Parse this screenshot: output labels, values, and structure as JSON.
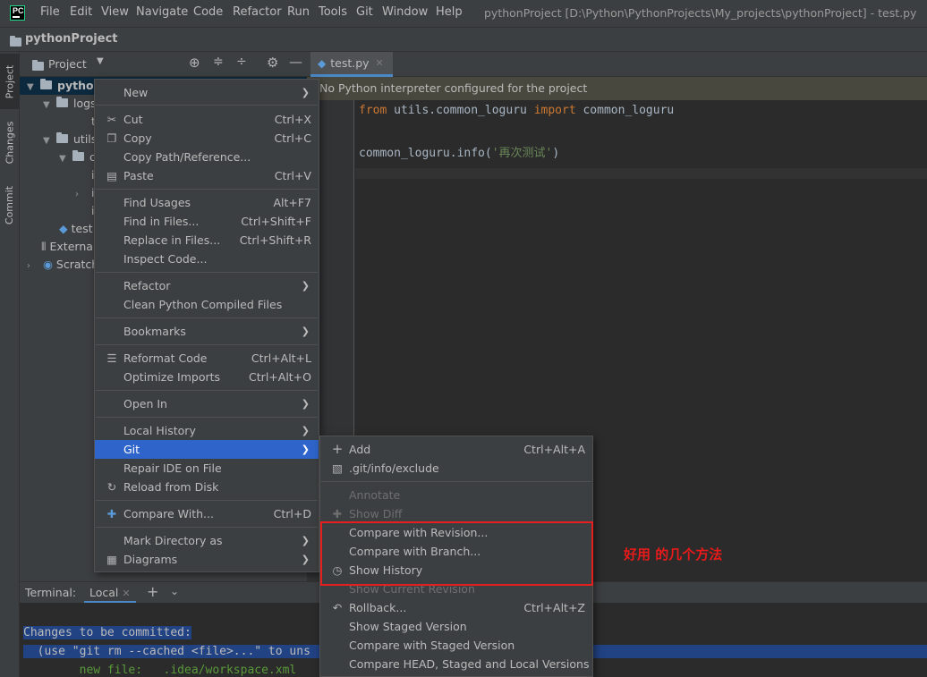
{
  "menubar": {
    "logo": "PC",
    "items": [
      "File",
      "Edit",
      "View",
      "Navigate",
      "Code",
      "Refactor",
      "Run",
      "Tools",
      "Git",
      "Window",
      "Help"
    ],
    "window_title": "pythonProject [D:\\Python\\PythonProjects\\My_projects\\pythonProject] - test.py"
  },
  "navbar": {
    "project": "pythonProject"
  },
  "tool_strip": {
    "project": "Project",
    "changes": "Changes",
    "commit": "Commit"
  },
  "project_panel": {
    "title": "Project",
    "tree": {
      "root": "pythonProject",
      "logs": "logs",
      "logs_child": "t",
      "utils": "utils",
      "utils_child": "c",
      "i1": "i",
      "i2": "i",
      "i3": "i",
      "test": "test",
      "external": "External",
      "scratches": "Scratch"
    }
  },
  "editor": {
    "tab": "test.py",
    "warning": "No Python interpreter configured for the project",
    "code": {
      "l1_from": "from",
      "l1_mod": " utils.common_loguru ",
      "l1_import": "import",
      "l1_name": " common_loguru",
      "l3_call": "common_loguru.info(",
      "l3_str": "'再次测试'",
      "l3_end": ")"
    }
  },
  "context_menu": {
    "new": "New",
    "cut": "Cut",
    "cut_sc": "Ctrl+X",
    "copy": "Copy",
    "copy_sc": "Ctrl+C",
    "copy_path": "Copy Path/Reference...",
    "paste": "Paste",
    "paste_sc": "Ctrl+V",
    "find_usages": "Find Usages",
    "find_usages_sc": "Alt+F7",
    "find_in_files": "Find in Files...",
    "find_in_files_sc": "Ctrl+Shift+F",
    "replace_in_files": "Replace in Files...",
    "replace_in_files_sc": "Ctrl+Shift+R",
    "inspect_code": "Inspect Code...",
    "refactor": "Refactor",
    "clean_python": "Clean Python Compiled Files",
    "bookmarks": "Bookmarks",
    "reformat": "Reformat Code",
    "reformat_sc": "Ctrl+Alt+L",
    "optimize": "Optimize Imports",
    "optimize_sc": "Ctrl+Alt+O",
    "open_in": "Open In",
    "local_history": "Local History",
    "git": "Git",
    "repair_ide": "Repair IDE on File",
    "reload": "Reload from Disk",
    "compare_with": "Compare With...",
    "compare_with_sc": "Ctrl+D",
    "mark_dir": "Mark Directory as",
    "diagrams": "Diagrams"
  },
  "git_menu": {
    "add": "Add",
    "add_sc": "Ctrl+Alt+A",
    "exclude": ".git/info/exclude",
    "annotate": "Annotate",
    "show_diff": "Show Diff",
    "compare_revision": "Compare with Revision...",
    "compare_branch": "Compare with Branch...",
    "show_history": "Show History",
    "show_current_revision": "Show Current Revision",
    "rollback": "Rollback...",
    "rollback_sc": "Ctrl+Alt+Z",
    "show_staged": "Show Staged Version",
    "compare_staged": "Compare with Staged Version",
    "compare_head": "Compare HEAD, Staged and Local Versions"
  },
  "annotation": "好用 的几个方法",
  "terminal": {
    "label": "Terminal:",
    "tab": "Local",
    "line1": "Changes to be committed:",
    "line2": "  (use \"git rm --cached <file>...\" to uns",
    "line3": "        new file:   .idea/workspace.xml"
  },
  "colors": {
    "accent": "#2f65ca",
    "annotation": "#e81a1a",
    "keyword": "#cc7832",
    "string": "#6a8759"
  }
}
